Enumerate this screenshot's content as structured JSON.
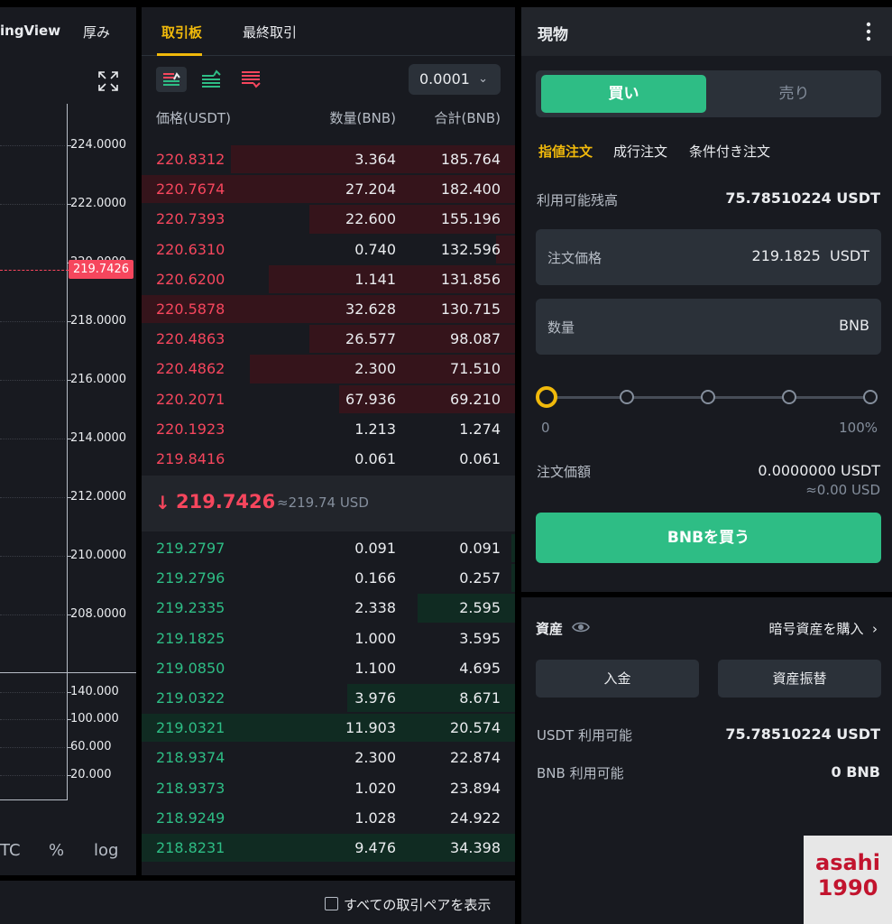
{
  "chart": {
    "tab_tradingview": "ingView",
    "tab_depth": "厚み",
    "price_ticks": [
      "224.0000",
      "222.0000",
      "220.0000",
      "218.0000",
      "216.0000",
      "214.0000",
      "212.0000",
      "210.0000",
      "208.0000"
    ],
    "current_price_tag": "219.7426",
    "volume_ticks": [
      "140.000",
      "100.000",
      "60.000",
      "20.000"
    ],
    "bottom_options": [
      "TC",
      "%",
      "log"
    ]
  },
  "orderbook": {
    "tab_active": "取引板",
    "tab_trades": "最終取引",
    "precision": "0.0001",
    "col_price": "価格(USDT)",
    "col_qty": "数量(BNB)",
    "col_total": "合計(BNB)",
    "asks": [
      {
        "price": "220.8312",
        "qty": "3.364",
        "total": "185.764",
        "depth": 0.76
      },
      {
        "price": "220.7674",
        "qty": "27.204",
        "total": "182.400",
        "depth": 1.0
      },
      {
        "price": "220.7393",
        "qty": "22.600",
        "total": "155.196",
        "depth": 0.55
      },
      {
        "price": "220.6310",
        "qty": "0.740",
        "total": "132.596",
        "depth": 0.05
      },
      {
        "price": "220.6200",
        "qty": "1.141",
        "total": "131.856",
        "depth": 0.66
      },
      {
        "price": "220.5878",
        "qty": "32.628",
        "total": "130.715",
        "depth": 1.0
      },
      {
        "price": "220.4863",
        "qty": "26.577",
        "total": "98.087",
        "depth": 0.55
      },
      {
        "price": "220.4862",
        "qty": "2.300",
        "total": "71.510",
        "depth": 0.71
      },
      {
        "price": "220.2071",
        "qty": "67.936",
        "total": "69.210",
        "depth": 0.47
      },
      {
        "price": "220.1923",
        "qty": "1.213",
        "total": "1.274",
        "depth": 0.0
      },
      {
        "price": "219.8416",
        "qty": "0.061",
        "total": "0.061",
        "depth": 0.0
      }
    ],
    "last_price": "219.7426",
    "last_price_usd": "≈219.74 USD",
    "bids": [
      {
        "price": "219.2797",
        "qty": "0.091",
        "total": "0.091",
        "depth": 0.01
      },
      {
        "price": "219.2796",
        "qty": "0.166",
        "total": "0.257",
        "depth": 0.01
      },
      {
        "price": "219.2335",
        "qty": "2.338",
        "total": "2.595",
        "depth": 0.26
      },
      {
        "price": "219.1825",
        "qty": "1.000",
        "total": "3.595",
        "depth": 0.0
      },
      {
        "price": "219.0850",
        "qty": "1.100",
        "total": "4.695",
        "depth": 0.0
      },
      {
        "price": "219.0322",
        "qty": "3.976",
        "total": "8.671",
        "depth": 0.45
      },
      {
        "price": "219.0321",
        "qty": "11.903",
        "total": "20.574",
        "depth": 1.0
      },
      {
        "price": "218.9374",
        "qty": "2.300",
        "total": "22.874",
        "depth": 0.0
      },
      {
        "price": "218.9373",
        "qty": "1.020",
        "total": "23.894",
        "depth": 0.0
      },
      {
        "price": "218.9249",
        "qty": "1.028",
        "total": "24.922",
        "depth": 0.0
      },
      {
        "price": "218.8231",
        "qty": "9.476",
        "total": "34.398",
        "depth": 1.0
      }
    ]
  },
  "trade": {
    "title": "現物",
    "buy_tab": "買い",
    "sell_tab": "売り",
    "order_types": [
      "指値注文",
      "成行注文",
      "条件付き注文"
    ],
    "available_label": "利用可能残高",
    "available_value": "75.78510224 USDT",
    "price_label": "注文価格",
    "price_value": "219.1825",
    "price_unit": "USDT",
    "amount_label": "数量",
    "amount_unit": "BNB",
    "slider_min": "0",
    "slider_max": "100%",
    "slider_level": 0.0,
    "total_label": "注文価額",
    "total_value": "0.0000000 USDT",
    "total_usd": "≈0.00 USD",
    "submit_label": "BNBを買う"
  },
  "assets": {
    "title": "資産",
    "buy_crypto": "暗号資産を購入",
    "deposit": "入金",
    "transfer": "資産振替",
    "usdt_label": "USDT 利用可能",
    "usdt_value": "75.78510224 USDT",
    "bnb_label": "BNB 利用可能",
    "bnb_value": "0 BNB"
  },
  "footer": {
    "show_all_pairs": "すべての取引ペアを表示"
  },
  "watermark": {
    "line1": "asahi",
    "line2": "1990"
  },
  "colors": {
    "ask": "#f6465d",
    "bid": "#2ebd85",
    "accent": "#f0b90b",
    "panel": "#181a20"
  }
}
